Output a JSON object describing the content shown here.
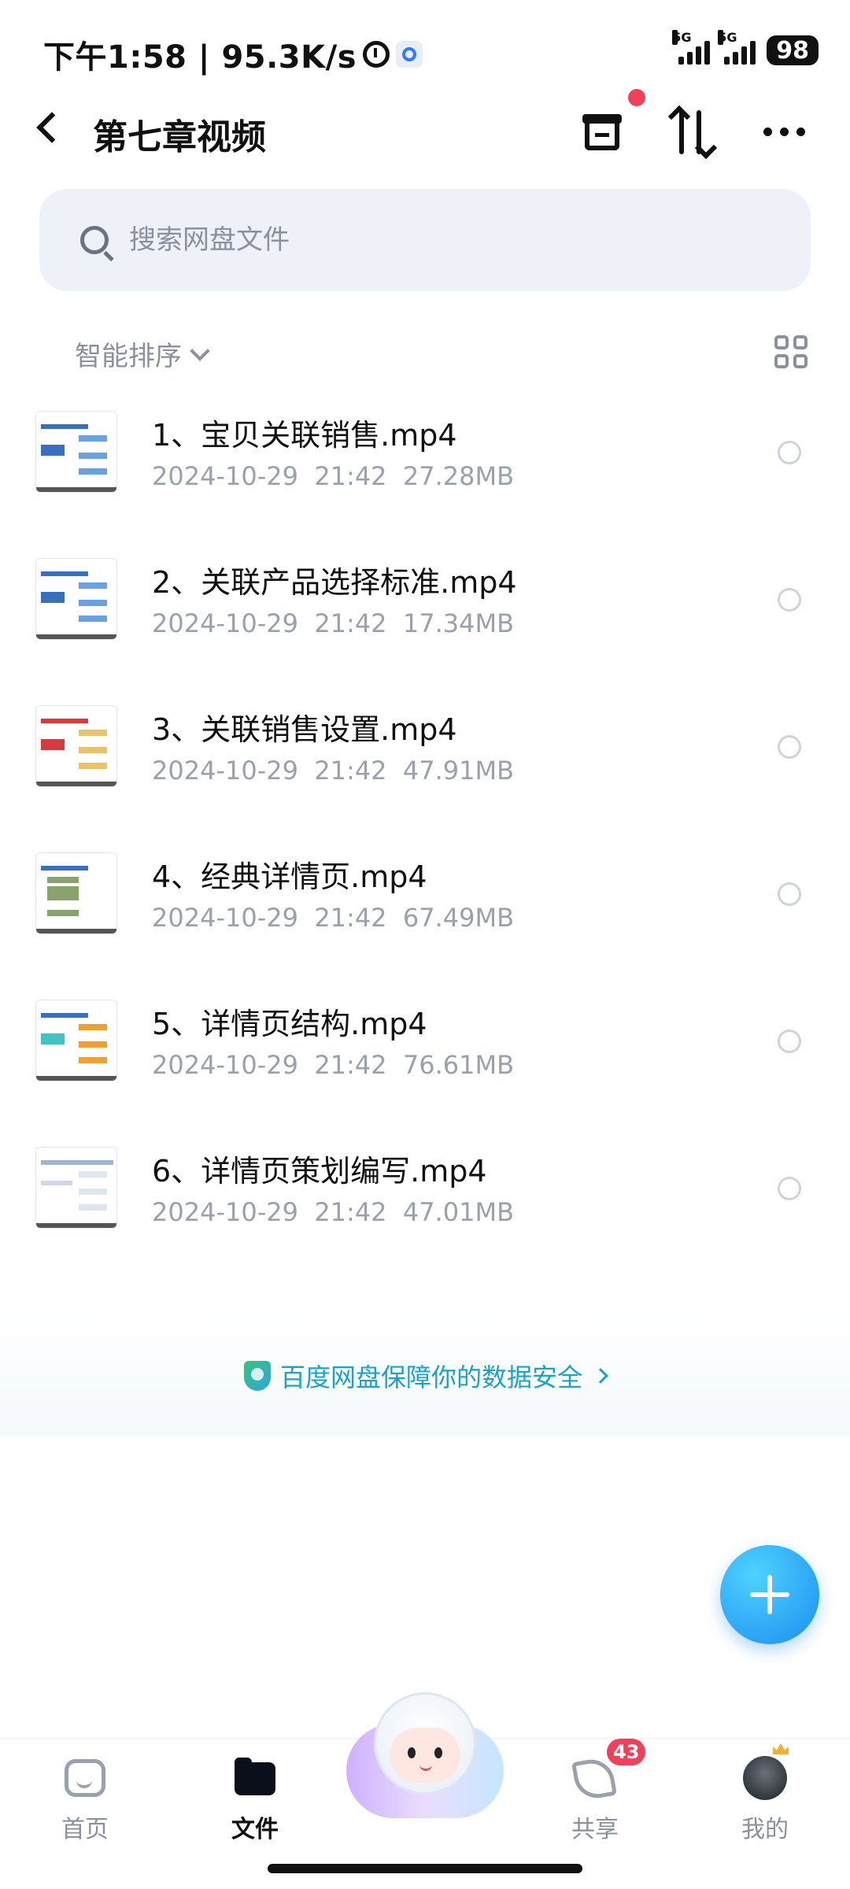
{
  "status_bar": {
    "time": "下午1:58 | 95.3K/s",
    "network_1": "5G",
    "network_2": "5G",
    "battery": "98"
  },
  "header": {
    "title": "第七章视频"
  },
  "search": {
    "placeholder": "搜索网盘文件"
  },
  "sort": {
    "label": "智能排序"
  },
  "files": [
    {
      "name": "1、宝贝关联销售.mp4",
      "date": "2024-10-29",
      "time": "21:42",
      "size": "27.28MB"
    },
    {
      "name": "2、关联产品选择标准.mp4",
      "date": "2024-10-29",
      "time": "21:42",
      "size": "17.34MB"
    },
    {
      "name": "3、关联销售设置.mp4",
      "date": "2024-10-29",
      "time": "21:42",
      "size": "47.91MB"
    },
    {
      "name": "4、经典详情页.mp4",
      "date": "2024-10-29",
      "time": "21:42",
      "size": "67.49MB"
    },
    {
      "name": "5、详情页结构.mp4",
      "date": "2024-10-29",
      "time": "21:42",
      "size": "76.61MB"
    },
    {
      "name": "6、详情页策划编写.mp4",
      "date": "2024-10-29",
      "time": "21:42",
      "size": "47.01MB"
    }
  ],
  "security_banner": {
    "text": "百度网盘保障你的数据安全"
  },
  "bottom_nav": {
    "home": "首页",
    "files": "文件",
    "share": "共享",
    "share_badge": "43",
    "mine": "我的"
  },
  "colors": {
    "accent": "#1a8ef0",
    "badge": "#f0405a",
    "secure_text": "#1aa3c8"
  }
}
